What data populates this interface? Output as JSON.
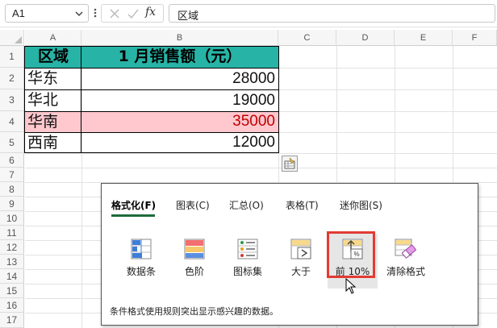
{
  "formula_bar": {
    "name_box": "A1",
    "fx_label": "fx",
    "content": "区域"
  },
  "columns": [
    "A",
    "B",
    "C",
    "D",
    "E",
    "F"
  ],
  "rows": [
    "1",
    "2",
    "3",
    "4",
    "5",
    "6",
    "7",
    "8",
    "9",
    "10",
    "11",
    "12",
    "13",
    "14",
    "15",
    "16",
    "17"
  ],
  "table": {
    "header": {
      "a": "区域",
      "b": "1 月销售额（元）"
    },
    "rows": [
      {
        "a": "华东",
        "b": "28000"
      },
      {
        "a": "华北",
        "b": "19000"
      },
      {
        "a": "华南",
        "b": "35000"
      },
      {
        "a": "西南",
        "b": "12000"
      }
    ]
  },
  "colors": {
    "header_fill": "#27b4a6",
    "highlight_fill": "#ffc7ce",
    "highlight_text": "#9c0006",
    "active_tab_underline": "#1d6b3a",
    "selection_outline": "#e23b33"
  },
  "quick_analysis": {
    "tabs": [
      {
        "label": "格式化(F)",
        "active": true
      },
      {
        "label": "图表(C)",
        "active": false
      },
      {
        "label": "汇总(O)",
        "active": false
      },
      {
        "label": "表格(T)",
        "active": false
      },
      {
        "label": "迷你图(S)",
        "active": false
      }
    ],
    "options": [
      {
        "label": "数据条",
        "icon": "data-bars-icon"
      },
      {
        "label": "色阶",
        "icon": "color-scale-icon"
      },
      {
        "label": "图标集",
        "icon": "icon-set-icon"
      },
      {
        "label": "大于",
        "icon": "greater-than-icon"
      },
      {
        "label": "前 10%",
        "icon": "top-10-percent-icon",
        "selected": true
      },
      {
        "label": "清除格式",
        "icon": "clear-format-icon"
      }
    ],
    "description": "条件格式使用规则突出显示感兴趣的数据。"
  }
}
